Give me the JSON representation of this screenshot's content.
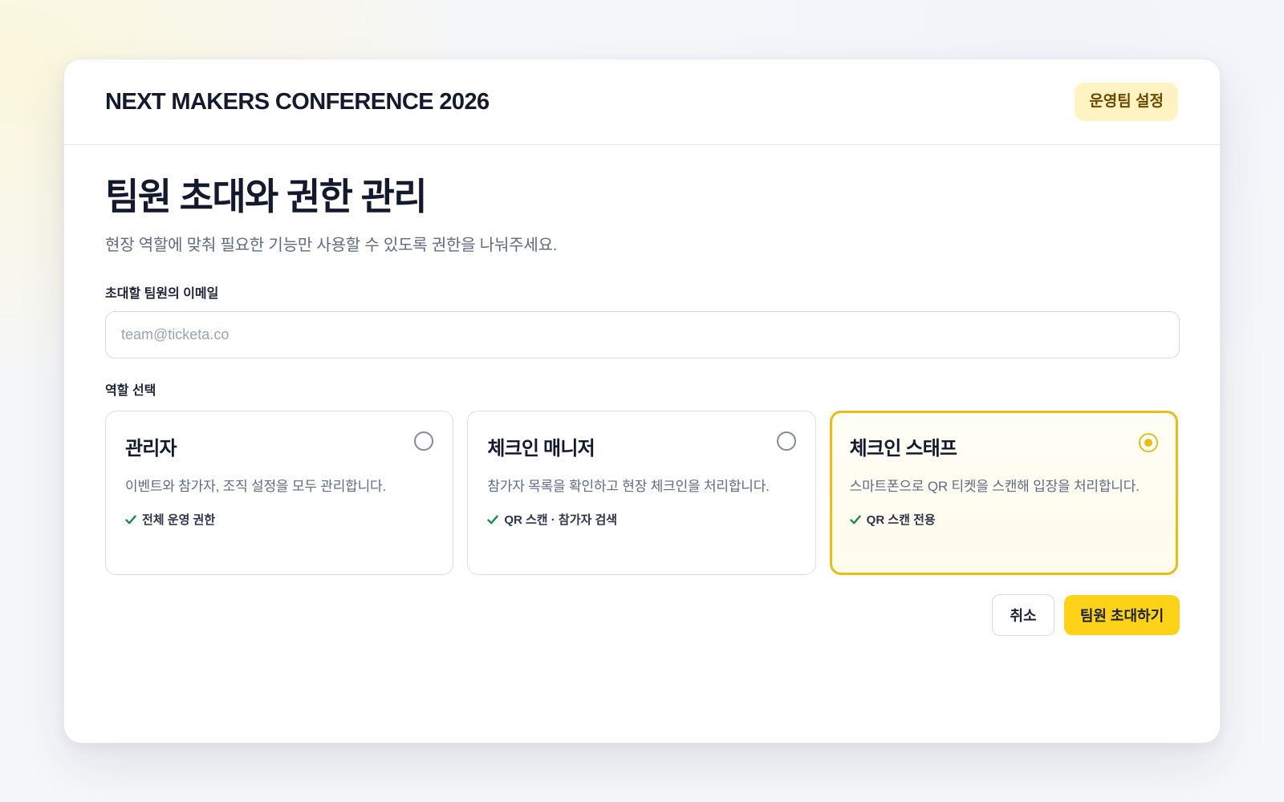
{
  "header": {
    "event_name": "NEXT MAKERS CONFERENCE 2026",
    "settings_badge": "운영팀 설정"
  },
  "main": {
    "title": "팀원 초대와 권한 관리",
    "subtitle": "현장 역할에 맞춰 필요한 기능만 사용할 수 있도록 권한을 나눠주세요.",
    "email_field": {
      "label": "초대할 팀원의 이메일",
      "value": "",
      "placeholder": "team@ticketa.co"
    },
    "role_section_label": "역할 선택",
    "roles": [
      {
        "title": "관리자",
        "description": "이벤트와 참가자, 조직 설정을 모두 관리합니다.",
        "permission": "전체 운영 권한",
        "selected": false
      },
      {
        "title": "체크인 매니저",
        "description": "참가자 목록을 확인하고 현장 체크인을 처리합니다.",
        "permission": "QR 스캔 · 참가자 검색",
        "selected": false
      },
      {
        "title": "체크인 스태프",
        "description": "스마트폰으로 QR 티켓을 스캔해 입장을 처리합니다.",
        "permission": "QR 스캔 전용",
        "selected": true
      }
    ],
    "actions": {
      "cancel_label": "취소",
      "invite_label": "팀원 초대하기"
    }
  },
  "icons": {
    "check": "check-icon",
    "radio": "radio-icon"
  },
  "colors": {
    "accent": "#ffd21a",
    "selected_border": "#e9bd14",
    "check_green": "#1f8a4c",
    "badge_bg": "#fff3c4",
    "badge_text": "#6b4a00"
  }
}
